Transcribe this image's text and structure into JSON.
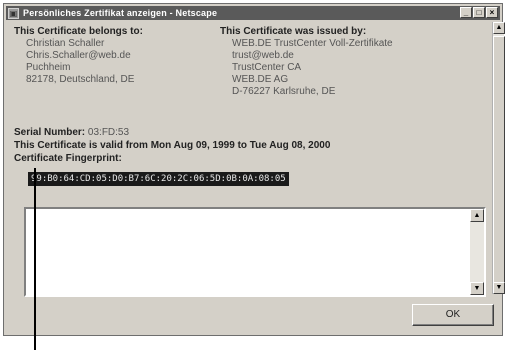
{
  "window": {
    "title": "Persönliches Zertifikat anzeigen - Netscape",
    "buttons": {
      "minimize": "_",
      "maximize": "□",
      "close": "×"
    }
  },
  "certificate": {
    "belongs_heading": "This Certificate belongs to:",
    "belongs_lines": [
      "Christian Schaller",
      "Chris.Schaller@web.de",
      "Puchheim",
      "82178, Deutschland, DE"
    ],
    "issued_heading": "This Certificate was issued by:",
    "issued_lines": [
      "WEB.DE TrustCenter Voll-Zertifikate",
      "trust@web.de",
      "TrustCenter CA",
      "WEB.DE AG",
      "D-76227 Karlsruhe, DE"
    ],
    "serial_label": "Serial Number:",
    "serial_value": "03:FD:53",
    "validity": "This Certificate is valid from Mon Aug 09, 1999 to Tue Aug 08, 2000",
    "fingerprint_label": "Certificate Fingerprint:",
    "fingerprint_value": "99:B0:64:CD:05:D0:B7:6C:20:2C:06:5D:0B:0A:08:05"
  },
  "textarea": {
    "value": ""
  },
  "buttons": {
    "ok": "OK"
  },
  "icons": {
    "app_icon": "certificate-icon",
    "scroll_up": "▲",
    "scroll_down": "▼"
  }
}
